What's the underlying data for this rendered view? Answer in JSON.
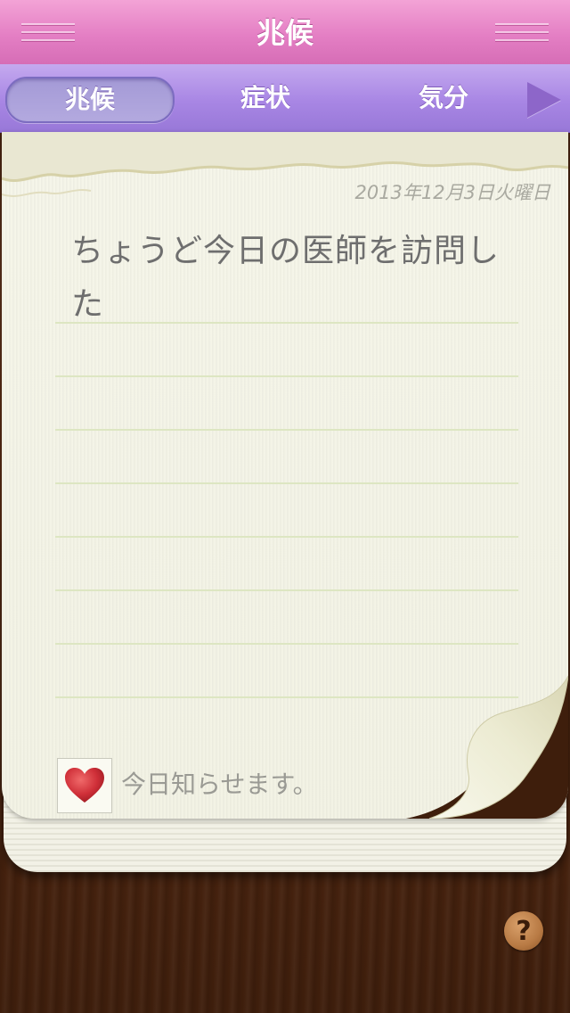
{
  "header": {
    "title": "兆候"
  },
  "tabs": [
    {
      "label": "兆候",
      "selected": true
    },
    {
      "label": "症状",
      "selected": false
    },
    {
      "label": "気分",
      "selected": false
    }
  ],
  "note": {
    "date": "2013年12月3日火曜日",
    "text": "ちょうど今日の医師を訪問した",
    "notify_label": "今日知らせます。"
  },
  "help": {
    "label": "?"
  },
  "icons": {
    "menu_left": "menu-icon",
    "menu_right": "menu-icon",
    "next": "play-arrow-icon",
    "heart": "heart-icon",
    "help": "question-mark-icon"
  },
  "colors": {
    "title_bar": "#e47fc4",
    "tab_bar": "#a886e4",
    "heart": "#c8323c",
    "paper": "#f6f6ea"
  }
}
